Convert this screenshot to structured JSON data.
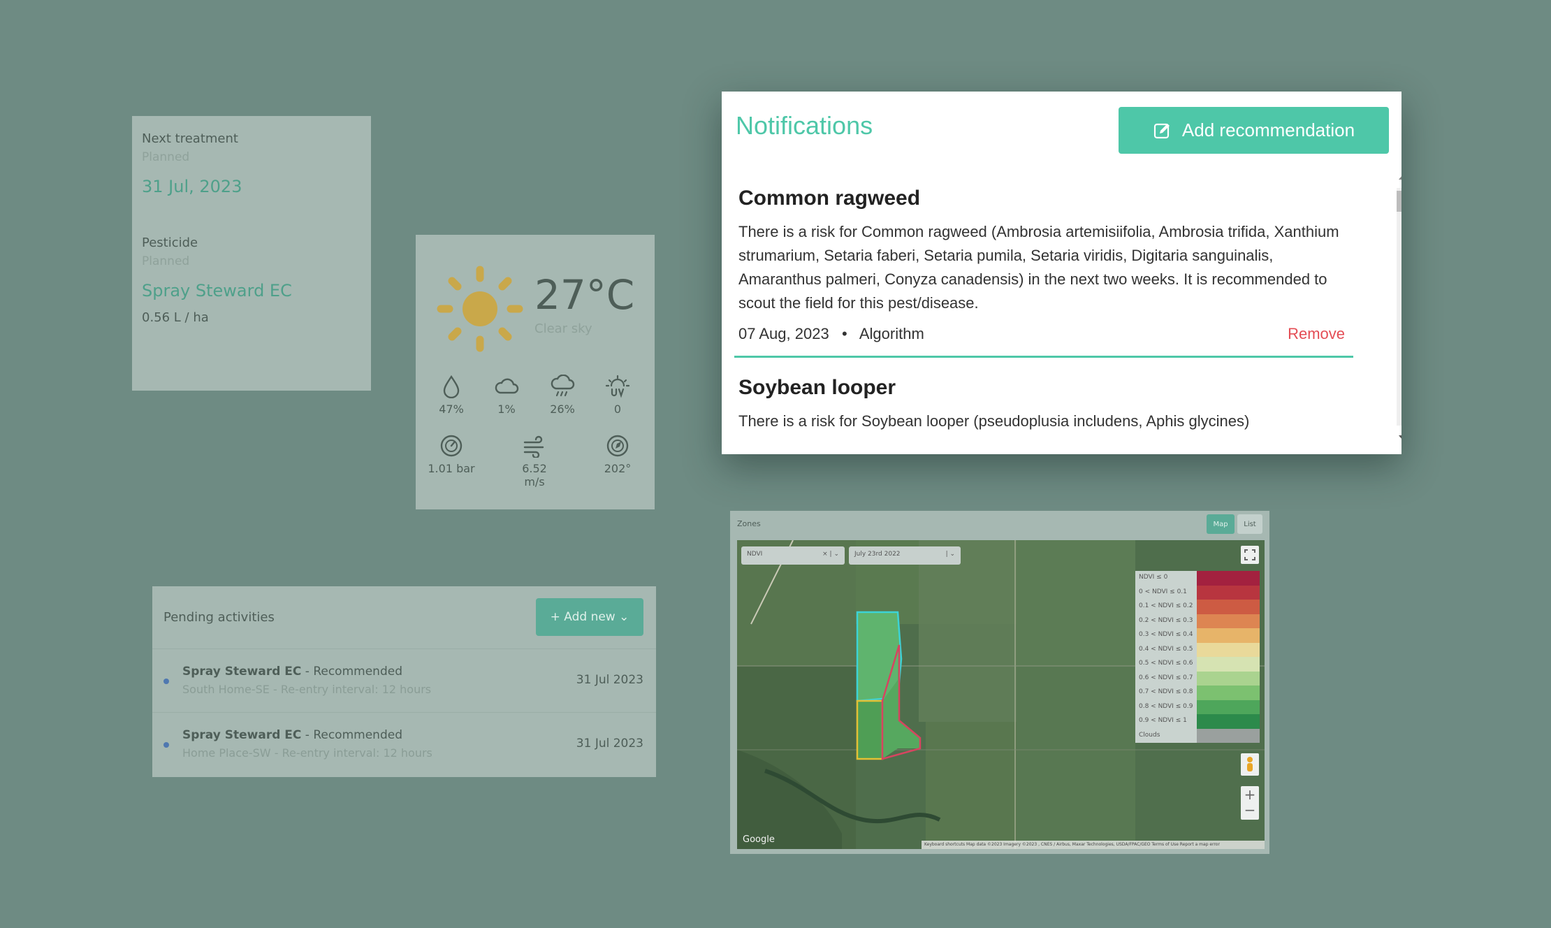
{
  "treatment": {
    "next_label": "Next treatment",
    "next_status": "Planned",
    "next_date": "31 Jul, 2023",
    "pesticide_label": "Pesticide",
    "pesticide_status": "Planned",
    "pesticide_name": "Spray Steward EC",
    "dose": "0.56 L / ha"
  },
  "weather": {
    "temperature": "27°C",
    "condition": "Clear sky",
    "humidity": "47%",
    "cloud_cover": "1%",
    "rain_chance": "26%",
    "uv": "0",
    "pressure": "1.01 bar",
    "wind_speed": "6.52 m/s",
    "wind_direction": "202°",
    "icons": [
      "sun-icon",
      "droplet-icon",
      "cloud-icon",
      "rain-cloud-icon",
      "uv-icon",
      "pressure-gauge-icon",
      "wind-icon",
      "compass-icon"
    ]
  },
  "pending": {
    "title": "Pending activities",
    "add_label": "+ Add new",
    "items": [
      {
        "product": "Spray Steward EC",
        "status": " - Recommended",
        "detail": "South Home-SE - Re-entry interval: 12 hours",
        "date": "31 Jul 2023"
      },
      {
        "product": "Spray Steward EC",
        "status": " - Recommended",
        "detail": "Home Place-SW - Re-entry interval: 12 hours",
        "date": "31 Jul 2023"
      }
    ]
  },
  "notifications": {
    "title": "Notifications",
    "add_label": "Add recommendation",
    "items": [
      {
        "title": "Common ragweed",
        "body": "There is a risk for Common ragweed (Ambrosia artemisiifolia, Ambrosia trifida, Xanthium strumarium, Setaria faberi, Setaria pumila, Setaria viridis, Digitaria sanguinalis, Amaranthus palmeri, Conyza canadensis) in the next two weeks. It is recommended to scout the field for this pest/disease.",
        "date": "07 Aug, 2023",
        "separator": "•",
        "source": "Algorithm",
        "remove_label": "Remove"
      },
      {
        "title": "Soybean looper",
        "body": "There is a risk for Soybean looper (pseudoplusia includens, Aphis glycines)"
      }
    ]
  },
  "map": {
    "title": "Zones",
    "map_label": "Map",
    "list_label": "List",
    "layer_value": "NDVI",
    "date_value": "July 23rd 2022",
    "google_label": "Google",
    "attribution": "Keyboard shortcuts   Map data ©2023 Imagery ©2023 , CNES / Airbus, Maxar Technologies, USDA/FPAC/GEO   Terms of Use   Report a map error",
    "legend": [
      {
        "label": "NDVI ≤ 0",
        "color": "#a3213f"
      },
      {
        "label": "0 < NDVI ≤ 0.1",
        "color": "#b8353f"
      },
      {
        "label": "0.1 < NDVI ≤ 0.2",
        "color": "#cd5b43"
      },
      {
        "label": "0.2 < NDVI ≤ 0.3",
        "color": "#dd8552"
      },
      {
        "label": "0.3 < NDVI ≤ 0.4",
        "color": "#e7b469"
      },
      {
        "label": "0.4 < NDVI ≤ 0.5",
        "color": "#e9d99a"
      },
      {
        "label": "0.5 < NDVI ≤ 0.6",
        "color": "#d6e3b2"
      },
      {
        "label": "0.6 < NDVI ≤ 0.7",
        "color": "#aad38f"
      },
      {
        "label": "0.7 < NDVI ≤ 0.8",
        "color": "#7cc170"
      },
      {
        "label": "0.8 < NDVI ≤ 0.9",
        "color": "#4ea65b"
      },
      {
        "label": "0.9 < NDVI ≤ 1",
        "color": "#2c8a4b"
      },
      {
        "label": "Clouds",
        "color": "#9aa09e"
      }
    ]
  }
}
